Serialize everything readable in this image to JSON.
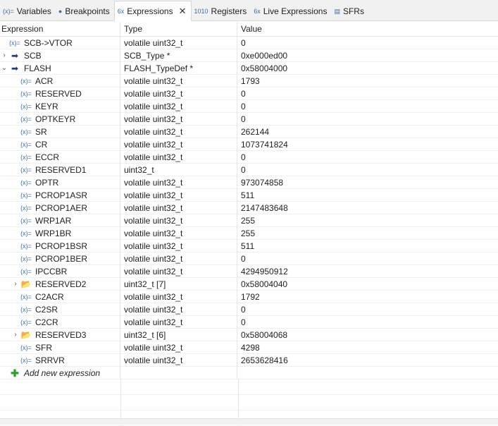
{
  "tabs": [
    {
      "label": "Variables",
      "icon": "(x)=",
      "icon_name": "variables-icon",
      "active": false
    },
    {
      "label": "Breakpoints",
      "icon": "●",
      "icon_name": "breakpoints-icon",
      "active": false
    },
    {
      "label": "Expressions",
      "icon": "6x",
      "icon_name": "expressions-icon",
      "active": true
    },
    {
      "label": "Registers",
      "icon": "1010",
      "icon_name": "registers-icon",
      "active": false
    },
    {
      "label": "Live Expressions",
      "icon": "6x",
      "icon_name": "live-expressions-icon",
      "active": false
    },
    {
      "label": "SFRs",
      "icon": "▤",
      "icon_name": "sfrs-icon",
      "active": false
    }
  ],
  "close_glyph": "✕",
  "columns": {
    "expression": "Expression",
    "type": "Type",
    "value": "Value"
  },
  "rows": [
    {
      "level": 0,
      "twisty": "",
      "icon": "var",
      "name": "SCB->VTOR",
      "type": "volatile uint32_t",
      "value": "0"
    },
    {
      "level": 0,
      "twisty": "›",
      "icon": "arrow",
      "name": "SCB",
      "type": "SCB_Type *",
      "value": "0xe000ed00"
    },
    {
      "level": 0,
      "twisty": "⌄",
      "icon": "arrow",
      "name": "FLASH",
      "type": "FLASH_TypeDef *",
      "value": "0x58004000"
    },
    {
      "level": 1,
      "twisty": "",
      "icon": "var",
      "name": "ACR",
      "type": "volatile uint32_t",
      "value": "1793"
    },
    {
      "level": 1,
      "twisty": "",
      "icon": "var",
      "name": "RESERVED",
      "type": "volatile uint32_t",
      "value": "0"
    },
    {
      "level": 1,
      "twisty": "",
      "icon": "var",
      "name": "KEYR",
      "type": "volatile uint32_t",
      "value": "0"
    },
    {
      "level": 1,
      "twisty": "",
      "icon": "var",
      "name": "OPTKEYR",
      "type": "volatile uint32_t",
      "value": "0"
    },
    {
      "level": 1,
      "twisty": "",
      "icon": "var",
      "name": "SR",
      "type": "volatile uint32_t",
      "value": "262144"
    },
    {
      "level": 1,
      "twisty": "",
      "icon": "var",
      "name": "CR",
      "type": "volatile uint32_t",
      "value": "1073741824"
    },
    {
      "level": 1,
      "twisty": "",
      "icon": "var",
      "name": "ECCR",
      "type": "volatile uint32_t",
      "value": "0"
    },
    {
      "level": 1,
      "twisty": "",
      "icon": "var",
      "name": "RESERVED1",
      "type": "uint32_t",
      "value": "0"
    },
    {
      "level": 1,
      "twisty": "",
      "icon": "var",
      "name": "OPTR",
      "type": "volatile uint32_t",
      "value": "973074858"
    },
    {
      "level": 1,
      "twisty": "",
      "icon": "var",
      "name": "PCROP1ASR",
      "type": "volatile uint32_t",
      "value": "511"
    },
    {
      "level": 1,
      "twisty": "",
      "icon": "var",
      "name": "PCROP1AER",
      "type": "volatile uint32_t",
      "value": "2147483648"
    },
    {
      "level": 1,
      "twisty": "",
      "icon": "var",
      "name": "WRP1AR",
      "type": "volatile uint32_t",
      "value": "255"
    },
    {
      "level": 1,
      "twisty": "",
      "icon": "var",
      "name": "WRP1BR",
      "type": "volatile uint32_t",
      "value": "255"
    },
    {
      "level": 1,
      "twisty": "",
      "icon": "var",
      "name": "PCROP1BSR",
      "type": "volatile uint32_t",
      "value": "511"
    },
    {
      "level": 1,
      "twisty": "",
      "icon": "var",
      "name": "PCROP1BER",
      "type": "volatile uint32_t",
      "value": "0"
    },
    {
      "level": 1,
      "twisty": "",
      "icon": "var",
      "name": "IPCCBR",
      "type": "volatile uint32_t",
      "value": "4294950912"
    },
    {
      "level": 1,
      "twisty": "›",
      "icon": "folder",
      "name": "RESERVED2",
      "type": "uint32_t [7]",
      "value": "0x58004040"
    },
    {
      "level": 1,
      "twisty": "",
      "icon": "var",
      "name": "C2ACR",
      "type": "volatile uint32_t",
      "value": "1792"
    },
    {
      "level": 1,
      "twisty": "",
      "icon": "var",
      "name": "C2SR",
      "type": "volatile uint32_t",
      "value": "0"
    },
    {
      "level": 1,
      "twisty": "",
      "icon": "var",
      "name": "C2CR",
      "type": "volatile uint32_t",
      "value": "0"
    },
    {
      "level": 1,
      "twisty": "›",
      "icon": "folder",
      "name": "RESERVED3",
      "type": "uint32_t [6]",
      "value": "0x58004068"
    },
    {
      "level": 1,
      "twisty": "",
      "icon": "var",
      "name": "SFR",
      "type": "volatile uint32_t",
      "value": "4298"
    },
    {
      "level": 1,
      "twisty": "",
      "icon": "var",
      "name": "SRRVR",
      "type": "volatile uint32_t",
      "value": "2653628416"
    }
  ],
  "var_icon": "(x)=",
  "add_expression": "Add new expression"
}
